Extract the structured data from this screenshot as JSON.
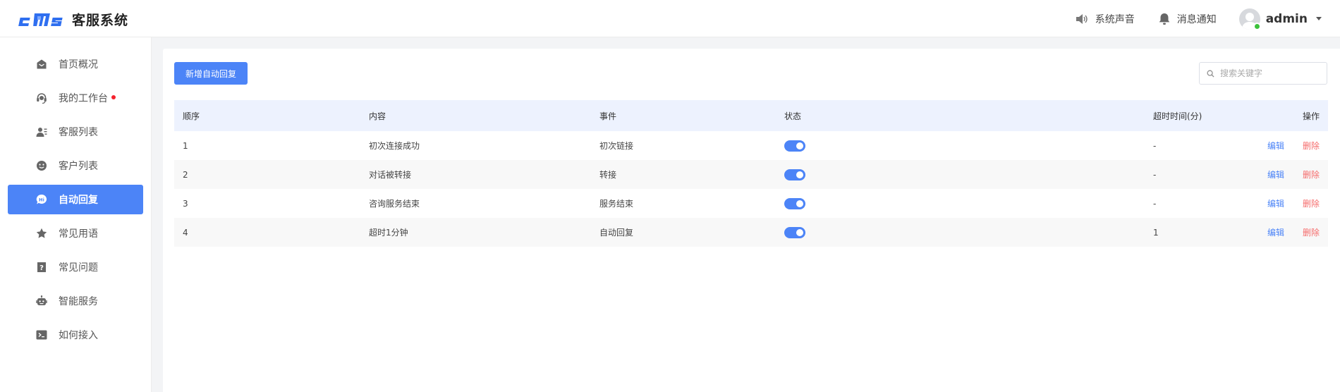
{
  "header": {
    "logo_mark": "cms",
    "app_title": "客服系统",
    "sound_label": "系统声音",
    "notify_label": "消息通知",
    "user_name": "admin"
  },
  "sidebar": {
    "items": [
      {
        "label": "首页概况",
        "icon": "home-icon"
      },
      {
        "label": "我的工作台",
        "icon": "headset-icon",
        "dot": true
      },
      {
        "label": "客服列表",
        "icon": "agent-list-icon"
      },
      {
        "label": "客户列表",
        "icon": "customer-icon"
      },
      {
        "label": "自动回复",
        "icon": "auto-reply-icon",
        "active": true
      },
      {
        "label": "常见用语",
        "icon": "star-icon"
      },
      {
        "label": "常见问题",
        "icon": "question-icon"
      },
      {
        "label": "智能服务",
        "icon": "robot-icon"
      },
      {
        "label": "如何接入",
        "icon": "terminal-icon"
      }
    ]
  },
  "toolbar": {
    "add_label": "新增自动回复",
    "search_placeholder": "搜索关键字"
  },
  "table": {
    "columns": [
      "顺序",
      "内容",
      "事件",
      "状态",
      "超时时间(分)",
      "操作"
    ],
    "rows": [
      {
        "order": "1",
        "content": "初次连接成功",
        "event": "初次链接",
        "enabled": true,
        "timeout": "-"
      },
      {
        "order": "2",
        "content": "对话被转接",
        "event": "转接",
        "enabled": true,
        "timeout": "-"
      },
      {
        "order": "3",
        "content": "咨询服务结束",
        "event": "服务结束",
        "enabled": true,
        "timeout": "-"
      },
      {
        "order": "4",
        "content": "超时1分钟",
        "event": "自动回复",
        "enabled": true,
        "timeout": "1"
      }
    ],
    "edit_label": "编辑",
    "delete_label": "删除"
  },
  "colors": {
    "accent": "#4c84f7",
    "danger": "#f56c6c",
    "online": "#3cc13b",
    "unread_dot": "#f5222d"
  }
}
